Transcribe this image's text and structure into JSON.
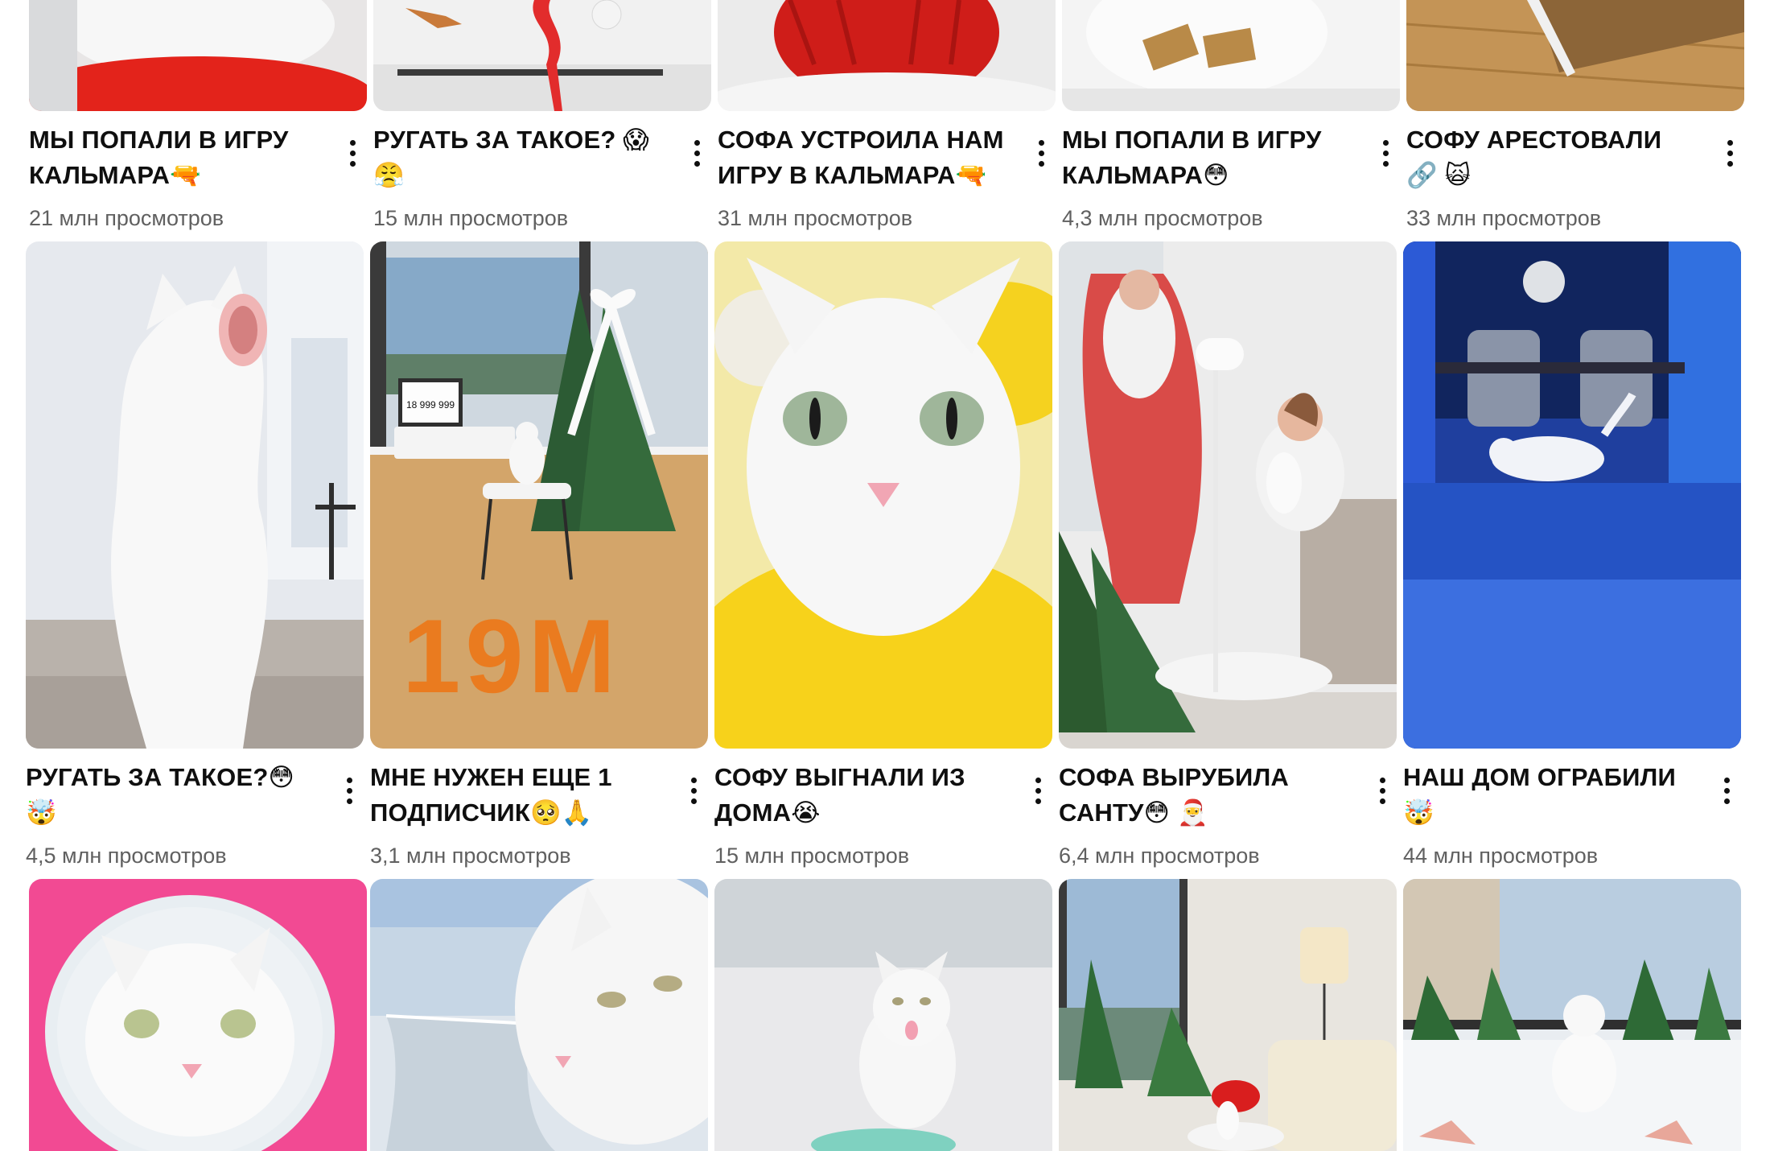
{
  "views_suffix": "млн просмотров",
  "rows": [
    {
      "items": [
        {
          "title": "МЫ ПОПАЛИ В ИГРУ КАЛЬМАРА🔫",
          "views": "21 млн просмотров"
        },
        {
          "title": "РУГАТЬ ЗА ТАКОЕ? 😱 😤",
          "views": "15 млн просмотров"
        },
        {
          "title": "СОФА УСТРОИЛА НАМ ИГРУ В КАЛЬМАРА🔫",
          "views": "31 млн просмотров"
        },
        {
          "title": "МЫ ПОПАЛИ В ИГРУ КАЛЬМАРА😳",
          "views": "4,3 млн просмотров"
        },
        {
          "title": "СОФУ АРЕСТОВАЛИ 🔗 🙀",
          "views": "33 млн просмотров"
        }
      ]
    },
    {
      "items": [
        {
          "title": "РУГАТЬ ЗА ТАКОЕ?😳 🤯",
          "views": "4,5 млн просмотров"
        },
        {
          "title": "МНЕ НУЖЕН ЕЩЕ 1 ПОДПИСЧИК🥺🙏",
          "views": "3,1 млн просмотров"
        },
        {
          "title": "СОФУ ВЫГНАЛИ ИЗ ДОМА😭",
          "views": "15 млн просмотров"
        },
        {
          "title": "СОФА ВЫРУБИЛА САНТУ😳 🎅",
          "views": "6,4 млн просмотров"
        },
        {
          "title": "НАШ ДОМ ОГРАБИЛИ 🤯",
          "views": "44 млн просмотров"
        }
      ]
    },
    {
      "items": [
        {
          "title": "",
          "views": ""
        },
        {
          "title": "",
          "views": ""
        },
        {
          "title": "",
          "views": ""
        },
        {
          "title": "",
          "views": ""
        },
        {
          "title": "",
          "views": ""
        }
      ]
    }
  ],
  "thumb_text": {
    "laptop_counter": "18 999 999",
    "floor_letters": "19M"
  },
  "icons": {
    "more": "more-vert-icon"
  },
  "colors": {
    "title": "#0f0f0f",
    "meta": "#606060",
    "background": "#ffffff"
  }
}
